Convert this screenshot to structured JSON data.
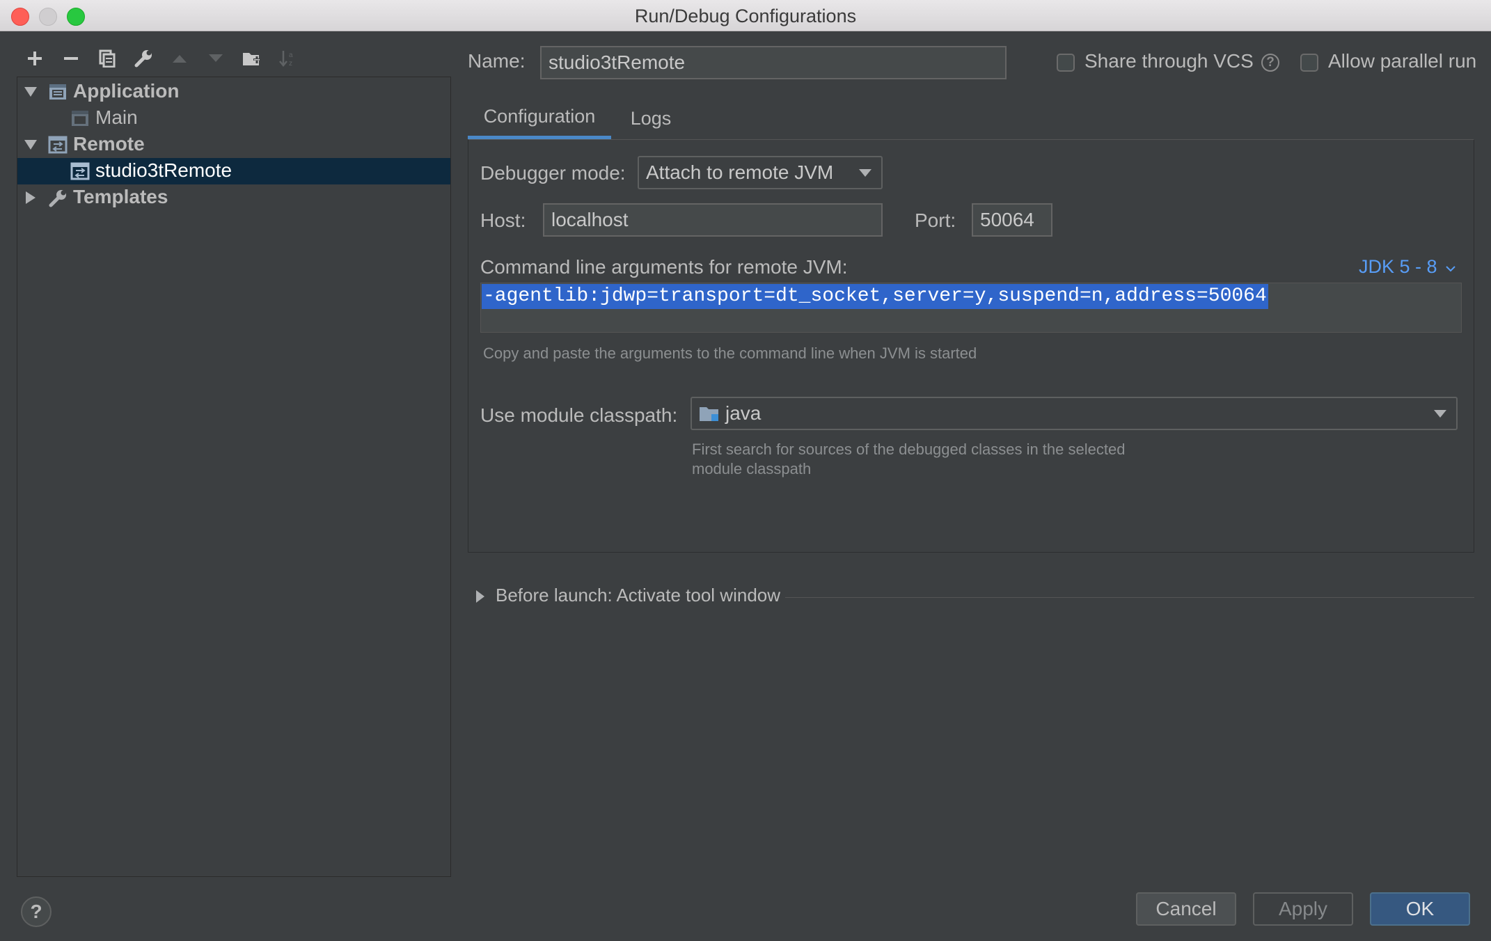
{
  "window": {
    "title": "Run/Debug Configurations"
  },
  "toolbar": {
    "icons": [
      "add-icon",
      "remove-icon",
      "copy-icon",
      "wrench-icon",
      "move-up-icon",
      "move-down-icon",
      "new-folder-icon",
      "sort-icon"
    ]
  },
  "tree": {
    "items": [
      {
        "label": "Application",
        "level": 0,
        "expanded": true,
        "bold": true,
        "icon": "application-config-icon"
      },
      {
        "label": "Main",
        "level": 1,
        "dim": true,
        "icon": "application-config-icon"
      },
      {
        "label": "Remote",
        "level": 0,
        "expanded": true,
        "bold": true,
        "icon": "remote-config-icon"
      },
      {
        "label": "studio3tRemote",
        "level": 1,
        "selected": true,
        "icon": "remote-config-icon"
      },
      {
        "label": "Templates",
        "level": 0,
        "expanded": false,
        "bold": true,
        "icon": "wrench-icon"
      }
    ]
  },
  "header": {
    "name_label": "Name:",
    "name_value": "studio3tRemote",
    "share_vcs_label": "Share through VCS",
    "share_vcs_checked": false,
    "help_glyph": "?",
    "allow_parallel_label": "Allow parallel run",
    "allow_parallel_checked": false
  },
  "tabs": [
    {
      "label": "Configuration",
      "active": true
    },
    {
      "label": "Logs",
      "active": false
    }
  ],
  "config": {
    "debugger_mode_label": "Debugger mode:",
    "debugger_mode_value": "Attach to remote JVM",
    "host_label": "Host:",
    "host_value": "localhost",
    "port_label": "Port:",
    "port_value": "50064",
    "cmd_label": "Command line arguments for remote JVM:",
    "jdk_link": "JDK 5 - 8",
    "cmd_value": "-agentlib:jdwp=transport=dt_socket,server=y,suspend=n,address=50064",
    "cmd_hint": "Copy and paste the arguments to the command line when JVM is started",
    "classpath_label": "Use module classpath:",
    "classpath_value": "java",
    "classpath_hint_line1": "First search for sources of the debugged classes in the selected",
    "classpath_hint_line2": "module classpath"
  },
  "before_launch": {
    "label": "Before launch: Activate tool window"
  },
  "buttons": {
    "cancel": "Cancel",
    "apply": "Apply",
    "ok": "OK",
    "help": "?"
  },
  "colors": {
    "accent": "#4a88c7",
    "selection": "#2f65ca",
    "tree_selection": "#0d293e",
    "ok_button": "#365880",
    "link": "#589df6"
  }
}
